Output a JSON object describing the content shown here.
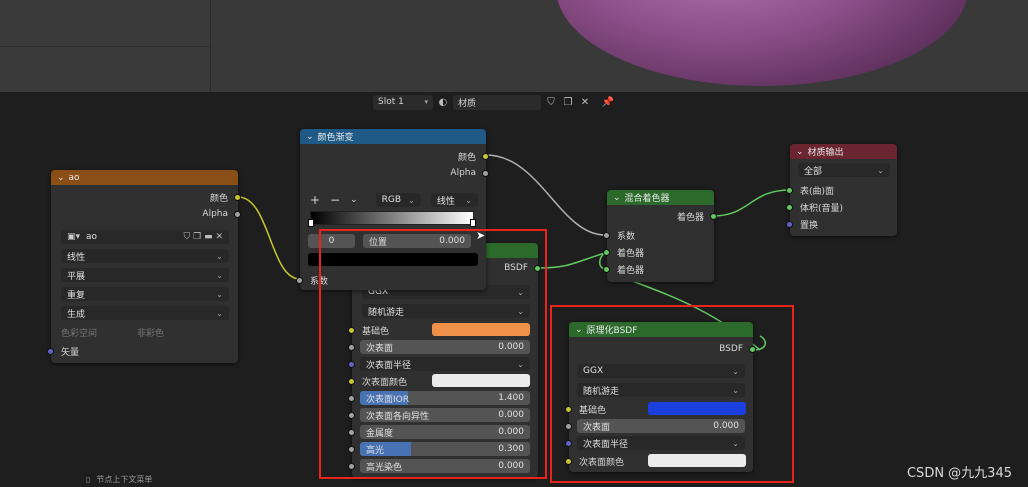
{
  "header": {
    "slot": "Slot 1",
    "material_name": "材质"
  },
  "node_ao": {
    "title": "ao",
    "out_color": "颜色",
    "out_alpha": "Alpha",
    "image_name": "ao",
    "interpolation": "线性",
    "projection": "平展",
    "extension": "重复",
    "source": "生成",
    "colorspace_label": "色彩空间",
    "colorspace_value": "非彩色",
    "in_vector": "矢量"
  },
  "node_ramp": {
    "title": "颜色渐变",
    "out_color": "颜色",
    "out_alpha": "Alpha",
    "add": "+",
    "remove": "−",
    "mode": "RGB",
    "interp": "线性",
    "index": "0",
    "pos_label": "位置",
    "pos_value": "0.000",
    "in_fac": "系数"
  },
  "node_bsdf1": {
    "out": "BSDF",
    "distribution": "GGX",
    "subsurface_method": "随机游走",
    "base_color": "基础色",
    "subsurface": "次表面",
    "subsurface_val": "0.000",
    "subsurface_radius": "次表面半径",
    "subsurface_color": "次表面颜色",
    "subsurface_ior": "次表面IOR",
    "subsurface_ior_val": "1.400",
    "subsurface_aniso": "次表面各向异性",
    "subsurface_aniso_val": "0.000",
    "metallic": "金属度",
    "metallic_val": "0.000",
    "specular": "高光",
    "specular_val": "0.300",
    "spec_tint": "高光染色",
    "spec_tint_val": "0.000",
    "specular_fraction": 0.3,
    "ior_fraction": 0.28
  },
  "node_mix": {
    "title": "混合着色器",
    "out": "着色器",
    "in_fac": "系数",
    "in_shader1": "着色器",
    "in_shader2": "着色器"
  },
  "node_output": {
    "title": "材质输出",
    "target": "全部",
    "in_surface": "表(曲)面",
    "in_volume": "体积(音量)",
    "in_disp": "置换"
  },
  "node_bsdf2": {
    "title": "原理化BSDF",
    "out": "BSDF",
    "distribution": "GGX",
    "subsurface_method": "随机游走",
    "base_color": "基础色",
    "subsurface": "次表面",
    "subsurface_val": "0.000",
    "subsurface_radius": "次表面半径",
    "subsurface_color": "次表面颜色"
  },
  "colors": {
    "texture_header": "#8a4f16",
    "converter_header": "#1f5a86",
    "shader_header": "#2b6a2b",
    "output_header": "#6a2530",
    "base_color_1": "#f0914a",
    "base_color_2": "#1c3fe0",
    "subsurface_color": "#ececec"
  },
  "status": {
    "context_menu": "节点上下文菜单"
  },
  "watermark": "CSDN @九九345"
}
